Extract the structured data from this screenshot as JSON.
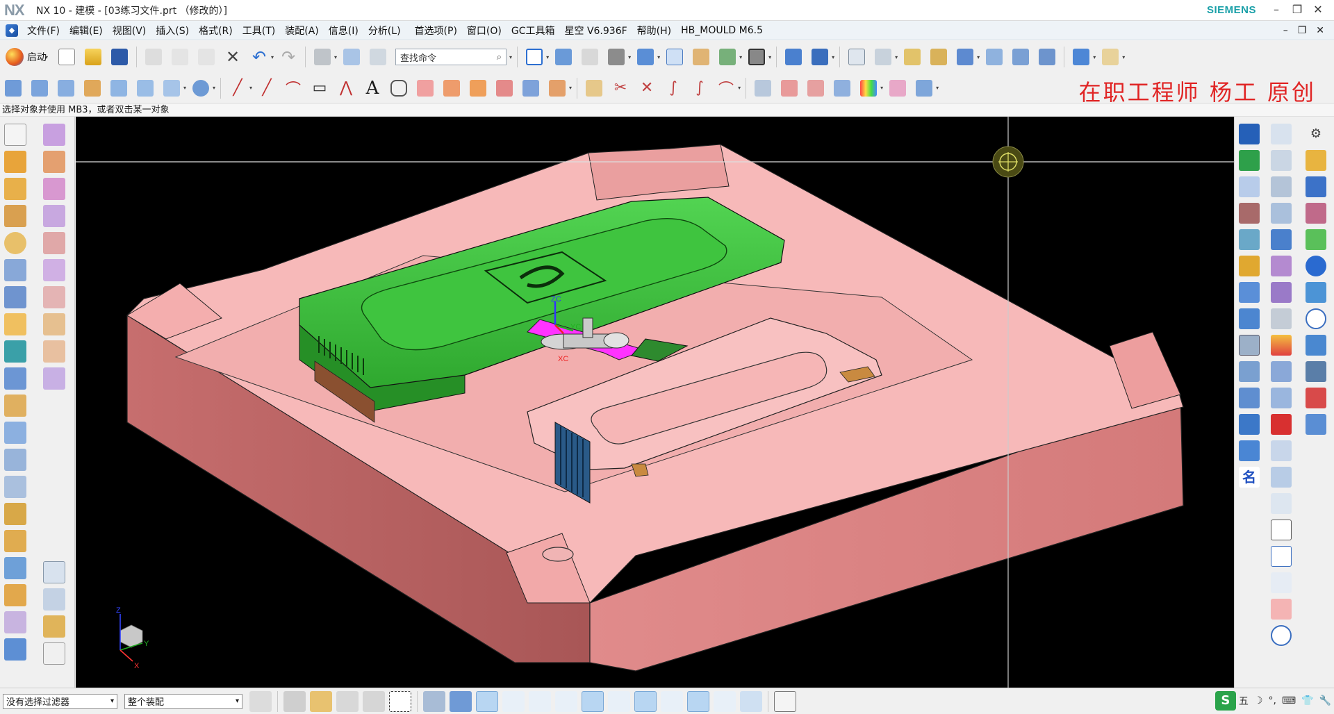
{
  "window": {
    "logo": "NX",
    "title": "NX 10 - 建模 - [03练习文件.prt （修改的）]",
    "brand": "SIEMENS",
    "controls": [
      "–",
      "❐",
      "✕"
    ]
  },
  "menu": {
    "items": [
      "文件(F)",
      "编辑(E)",
      "视图(V)",
      "插入(S)",
      "格式(R)",
      "工具(T)",
      "装配(A)",
      "信息(I)",
      "分析(L)",
      "首选项(P)",
      "窗口(O)",
      "GC工具箱",
      "星空 V6.936F",
      "帮助(H)",
      "HB_MOULD M6.5"
    ],
    "doc_controls": [
      "–",
      "❐",
      "✕"
    ]
  },
  "toolbar": {
    "start_label": "启动",
    "search_placeholder": "查找命令",
    "search_icon": "search-icon"
  },
  "promo_text": "在职工程师 杨工 原创",
  "status": {
    "prompt": "选择对象并使用 MB3，或者双击某一对象"
  },
  "viewport": {
    "axis_labels": {
      "zc": "ZC",
      "yc": "YC",
      "xc": "XC"
    },
    "triad": {
      "x": "X",
      "y": "Y",
      "z": "Z"
    },
    "colors": {
      "background": "#000000",
      "mold": "#f5b5b5",
      "mold_side": "#d97a7a",
      "insert": "#3fc43f",
      "slider": "#ff33ff"
    }
  },
  "bottom": {
    "filter_value": "没有选择过滤器",
    "scope_value": "整个装配",
    "tray": [
      "五",
      "☽",
      "°,",
      "⌨",
      "👕",
      "🔧"
    ]
  }
}
